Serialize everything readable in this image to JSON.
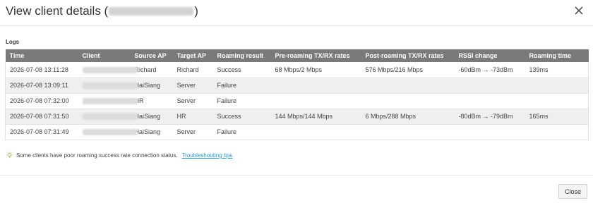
{
  "dialog": {
    "title_prefix": "View client details (",
    "title_suffix": ")",
    "section_label": "Logs"
  },
  "table": {
    "columns": [
      "Time",
      "Client",
      "Source AP",
      "Target AP",
      "Roaming result",
      "Pre-roaming TX/RX rates",
      "Post-roaming TX/RX rates",
      "RSSI change",
      "Roaming time"
    ],
    "rows": [
      {
        "time": "2026-07-08 13:11:28",
        "source_ap": "Richard",
        "target_ap": "Richard",
        "result": "Success",
        "pre_rates": "68 Mbps/2 Mbps",
        "post_rates": "576 Mbps/216 Mbps",
        "rssi": "-60dBm → -73dBm",
        "roaming_time": "139ms"
      },
      {
        "time": "2026-07-08 13:09:11",
        "source_ap": "HaiSiang",
        "target_ap": "Server",
        "result": "Failure",
        "pre_rates": "",
        "post_rates": "",
        "rssi": "",
        "roaming_time": ""
      },
      {
        "time": "2026-07-08 07:32:00",
        "source_ap": "HR",
        "target_ap": "Server",
        "result": "Failure",
        "pre_rates": "",
        "post_rates": "",
        "rssi": "",
        "roaming_time": ""
      },
      {
        "time": "2026-07-08 07:31:50",
        "source_ap": "HaiSiang",
        "target_ap": "HR",
        "result": "Success",
        "pre_rates": "144 Mbps/144 Mbps",
        "post_rates": "6 Mbps/288 Mbps",
        "rssi": "-80dBm → -79dBm",
        "roaming_time": "165ms"
      },
      {
        "time": "2026-07-08 07:31:49",
        "source_ap": "HaiSiang",
        "target_ap": "Server",
        "result": "Failure",
        "pre_rates": "",
        "post_rates": "",
        "rssi": "",
        "roaming_time": ""
      }
    ]
  },
  "tip": {
    "text": "Some clients have poor roaming success rate connection status.",
    "link": "Troubleshooting tips",
    "icon": "lightbulb-icon",
    "icon_color": "#9bc53d"
  },
  "footer": {
    "close_label": "Close"
  },
  "colors": {
    "header_bg": "#7a7a7a",
    "link": "#1a9bd7"
  }
}
